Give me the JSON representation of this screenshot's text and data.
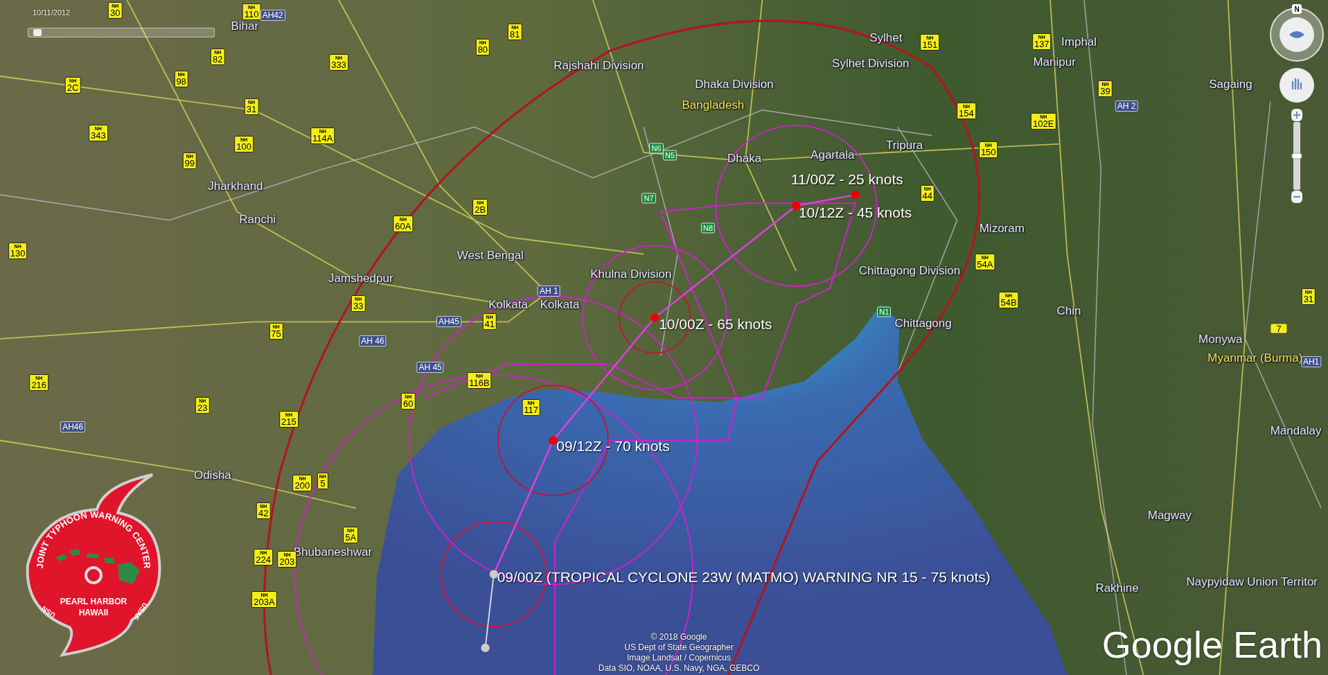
{
  "date_slider": {
    "label": "10/11/2012",
    "level": 0.05
  },
  "place_labels": [
    {
      "kind": "region",
      "text": "Bihar"
    },
    {
      "kind": "region",
      "text": "Rajshahi Division"
    },
    {
      "kind": "region",
      "text": "Dhaka Division"
    },
    {
      "kind": "country",
      "text": "Bangladesh"
    },
    {
      "kind": "city",
      "text": "Sylhet"
    },
    {
      "kind": "region",
      "text": "Sylhet Division"
    },
    {
      "kind": "city",
      "text": "Imphal"
    },
    {
      "kind": "region",
      "text": "Manipur"
    },
    {
      "kind": "region",
      "text": "Sagaing"
    },
    {
      "kind": "region",
      "text": "Jharkhand"
    },
    {
      "kind": "city",
      "text": "Ranchi"
    },
    {
      "kind": "city",
      "text": "Dhaka"
    },
    {
      "kind": "city",
      "text": "Agartala"
    },
    {
      "kind": "region",
      "text": "Tripura"
    },
    {
      "kind": "region",
      "text": "Mizoram"
    },
    {
      "kind": "region",
      "text": "West Bengal"
    },
    {
      "kind": "region",
      "text": "Khulna Division"
    },
    {
      "kind": "city",
      "text": "Jamshedpur"
    },
    {
      "kind": "city",
      "text": "Kolkata"
    },
    {
      "kind": "city",
      "text": "Kolkata"
    },
    {
      "kind": "region",
      "text": "Chittagong Division"
    },
    {
      "kind": "city",
      "text": "Chittagong"
    },
    {
      "kind": "region",
      "text": "Chin"
    },
    {
      "kind": "city",
      "text": "Monywa"
    },
    {
      "kind": "country",
      "text": "Myanmar (Burma)"
    },
    {
      "kind": "city",
      "text": "Mandalay"
    },
    {
      "kind": "region",
      "text": "Odisha"
    },
    {
      "kind": "region",
      "text": "Magway"
    },
    {
      "kind": "city",
      "text": "Bhubaneshwar"
    },
    {
      "kind": "region",
      "text": "Rakhine"
    },
    {
      "kind": "region",
      "text": "Naypyidaw Union Territor"
    }
  ],
  "road_shields": [
    {
      "kind": "nh",
      "prefix": "NH",
      "number": "30"
    },
    {
      "kind": "nh",
      "prefix": "NH",
      "number": "110"
    },
    {
      "kind": "ah",
      "number": "AH42"
    },
    {
      "kind": "nh",
      "prefix": "NH",
      "number": "82"
    },
    {
      "kind": "nh",
      "prefix": "NH",
      "number": "98"
    },
    {
      "kind": "nh",
      "prefix": "NH",
      "number": "333"
    },
    {
      "kind": "nh",
      "prefix": "NH",
      "number": "81"
    },
    {
      "kind": "nh",
      "prefix": "NH",
      "number": "80"
    },
    {
      "kind": "nh",
      "prefix": "NH",
      "number": "2C"
    },
    {
      "kind": "nh",
      "prefix": "NH",
      "number": "343"
    },
    {
      "kind": "nh",
      "prefix": "NH",
      "number": "31"
    },
    {
      "kind": "nh",
      "prefix": "NH",
      "number": "114A"
    },
    {
      "kind": "nh",
      "prefix": "NH",
      "number": "100"
    },
    {
      "kind": "nh",
      "prefix": "NH",
      "number": "99"
    },
    {
      "kind": "nh",
      "prefix": "NH",
      "number": "60A"
    },
    {
      "kind": "nh",
      "prefix": "NH",
      "number": "2B"
    },
    {
      "kind": "nh",
      "prefix": "NH",
      "number": "130"
    },
    {
      "kind": "nh",
      "prefix": "NH",
      "number": "33"
    },
    {
      "kind": "nh",
      "prefix": "NH",
      "number": "75"
    },
    {
      "kind": "ah",
      "number": "AH 46"
    },
    {
      "kind": "ah",
      "number": "AH45"
    },
    {
      "kind": "nh",
      "prefix": "NH",
      "number": "41"
    },
    {
      "kind": "ah",
      "number": "AH 1"
    },
    {
      "kind": "ah",
      "number": "AH 45"
    },
    {
      "kind": "nh",
      "prefix": "NH",
      "number": "216"
    },
    {
      "kind": "ah",
      "number": "AH46"
    },
    {
      "kind": "nh",
      "prefix": "NH",
      "number": "23"
    },
    {
      "kind": "nh",
      "prefix": "NH",
      "number": "215"
    },
    {
      "kind": "nh",
      "prefix": "NH",
      "number": "60"
    },
    {
      "kind": "nh",
      "prefix": "NH",
      "number": "116B"
    },
    {
      "kind": "nh",
      "prefix": "NH",
      "number": "117"
    },
    {
      "kind": "nh",
      "prefix": "NH",
      "number": "200"
    },
    {
      "kind": "nh",
      "prefix": "NH",
      "number": "5"
    },
    {
      "kind": "nh",
      "prefix": "NH",
      "number": "42"
    },
    {
      "kind": "nh",
      "prefix": "NH",
      "number": "5A"
    },
    {
      "kind": "nh",
      "prefix": "NH",
      "number": "224"
    },
    {
      "kind": "nh",
      "prefix": "NH",
      "number": "203"
    },
    {
      "kind": "nh",
      "prefix": "NH",
      "number": "203A"
    },
    {
      "kind": "n",
      "number": "N6"
    },
    {
      "kind": "n",
      "number": "N5"
    },
    {
      "kind": "n",
      "number": "N7"
    },
    {
      "kind": "n",
      "number": "N8"
    },
    {
      "kind": "n",
      "number": "N1"
    },
    {
      "kind": "nh",
      "prefix": "NH",
      "number": "44"
    },
    {
      "kind": "nh",
      "prefix": "NH",
      "number": "150"
    },
    {
      "kind": "nh",
      "prefix": "NH",
      "number": "154"
    },
    {
      "kind": "nh",
      "prefix": "NH",
      "number": "151"
    },
    {
      "kind": "nh",
      "prefix": "NH",
      "number": "137"
    },
    {
      "kind": "nh",
      "prefix": "NH",
      "number": "39"
    },
    {
      "kind": "ah",
      "number": "AH 2"
    },
    {
      "kind": "nh",
      "prefix": "NH",
      "number": "102E"
    },
    {
      "kind": "nh",
      "prefix": "NH",
      "number": "54A"
    },
    {
      "kind": "nh",
      "prefix": "NH",
      "number": "54B"
    },
    {
      "kind": "nh",
      "prefix": "NH",
      "number": "31"
    },
    {
      "kind": "plain",
      "number": "7"
    },
    {
      "kind": "ah",
      "number": "AH1"
    }
  ],
  "track_labels": [
    "11/00Z - 25 knots",
    "10/12Z - 45 knots",
    "10/00Z - 65 knots",
    "09/12Z - 70 knots",
    "09/00Z (TROPICAL CYCLONE 23W (MATMO) WARNING NR 15 - 75 knots)"
  ],
  "logo": {
    "arc_text": "JOINT TYPHOON WARNING CENTER",
    "lines": [
      "PEARL HARBOR",
      "HAWAII"
    ],
    "left_text": "USN",
    "right_text": "USAF"
  },
  "navigation": {
    "north": "N",
    "zoom_slider": {
      "level": 0.5
    }
  },
  "attribution": [
    "© 2018 Google",
    "US Dept of State Geographer",
    "Image Landsat / Copernicus",
    "Data SIO, NOAA, U.S. Navy, NGA, GEBCO"
  ],
  "brand": "Google Earth"
}
